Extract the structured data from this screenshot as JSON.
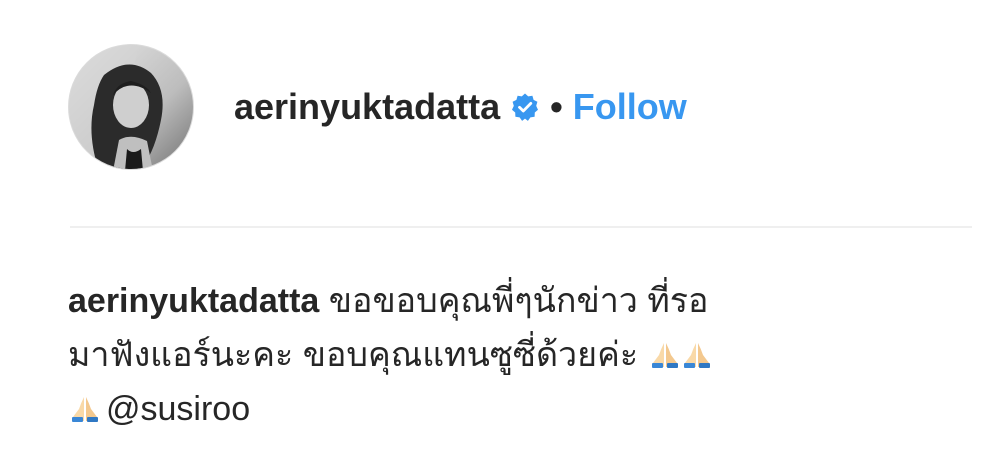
{
  "post": {
    "username": "aerinyuktadatta",
    "separator": "•",
    "follow_label": "Follow",
    "verified_icon": "verified-badge-icon",
    "brand_color": "#3897f0",
    "caption": {
      "username": "aerinyuktadatta",
      "line1_text": "ขอขอบคุณพี่ๆนักข่าว ที่รอ",
      "line2_text": "มาฟังแอร์นะคะ ขอบคุณแทนซูซี่ด้วยค่ะ",
      "emoji_icon": "folded-hands-icon",
      "mention": "@susiroo"
    }
  }
}
